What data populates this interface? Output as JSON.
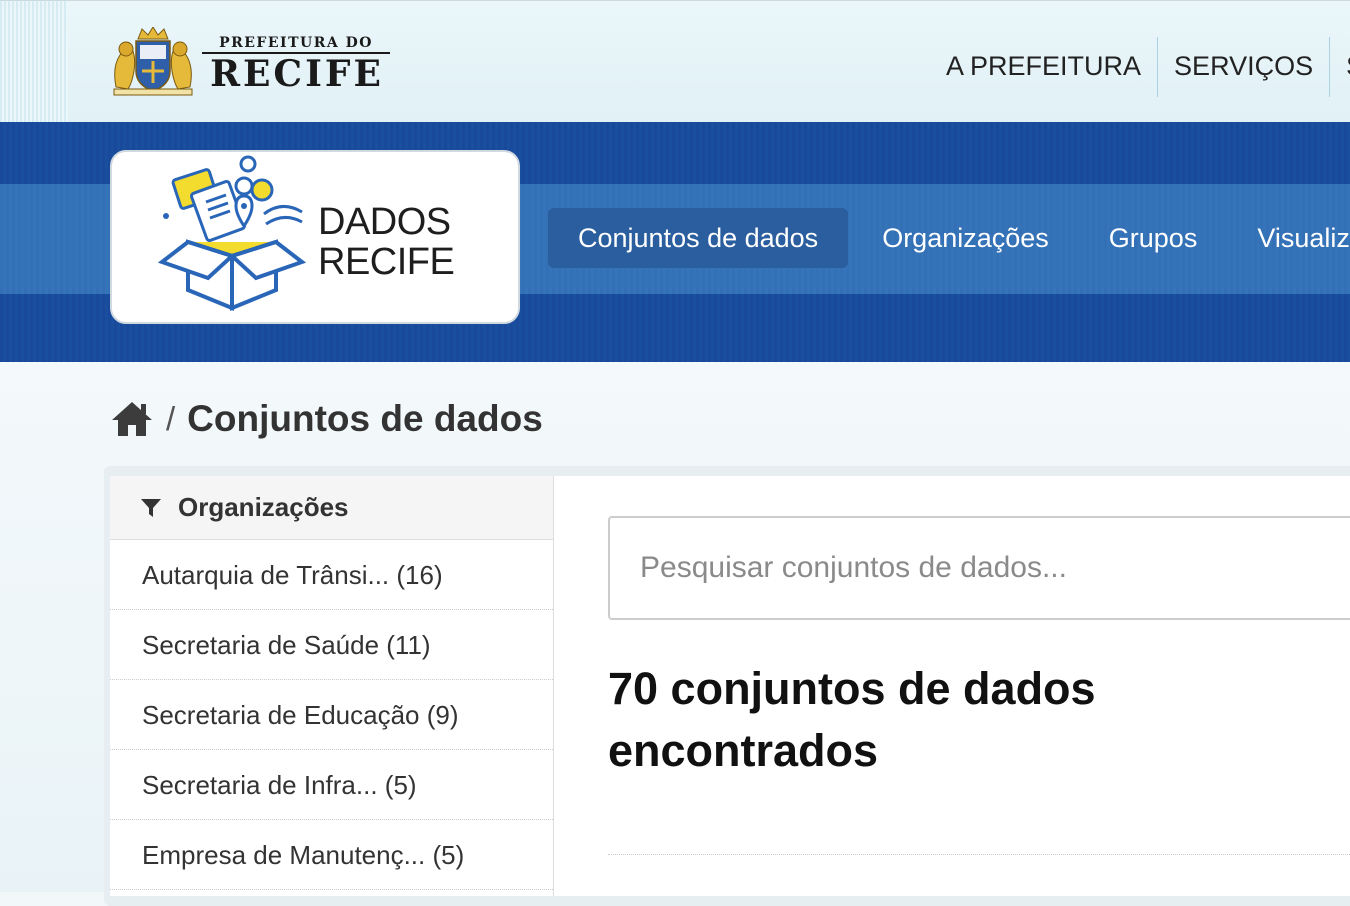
{
  "header": {
    "city_logo": {
      "subtitle": "PREFEITURA DO",
      "title": "RECIFE"
    },
    "top_nav": [
      "A PREFEITURA",
      "SERVIÇOS",
      "S"
    ]
  },
  "site_logo": {
    "line1": "DADOS",
    "line2": "RECIFE"
  },
  "main_nav": {
    "items": [
      "Conjuntos de dados",
      "Organizações",
      "Grupos",
      "Visualiza"
    ],
    "active": "Conjuntos de dados"
  },
  "breadcrumb": {
    "separator": "/",
    "current": "Conjuntos de dados"
  },
  "sidebar": {
    "title": "Organizações",
    "items": [
      {
        "label": "Autarquia de Trânsi... (16)"
      },
      {
        "label": "Secretaria de Saúde (11)"
      },
      {
        "label": "Secretaria de Educação (9)"
      },
      {
        "label": "Secretaria de Infra... (5)"
      },
      {
        "label": "Empresa de Manutenç... (5)"
      }
    ]
  },
  "search": {
    "placeholder": "Pesquisar conjuntos de dados...",
    "value": ""
  },
  "results": {
    "heading": "70 conjuntos de dados encontrados"
  },
  "colors": {
    "band_dark": "#184b98",
    "band_light": "#3470b6",
    "nav_active": "#2a5e9e",
    "logo_yellow": "#f4dc2e",
    "logo_blue": "#2a66b8"
  },
  "icons": [
    "city-crest-icon",
    "home-icon",
    "filter-icon",
    "dados-box-icon"
  ]
}
